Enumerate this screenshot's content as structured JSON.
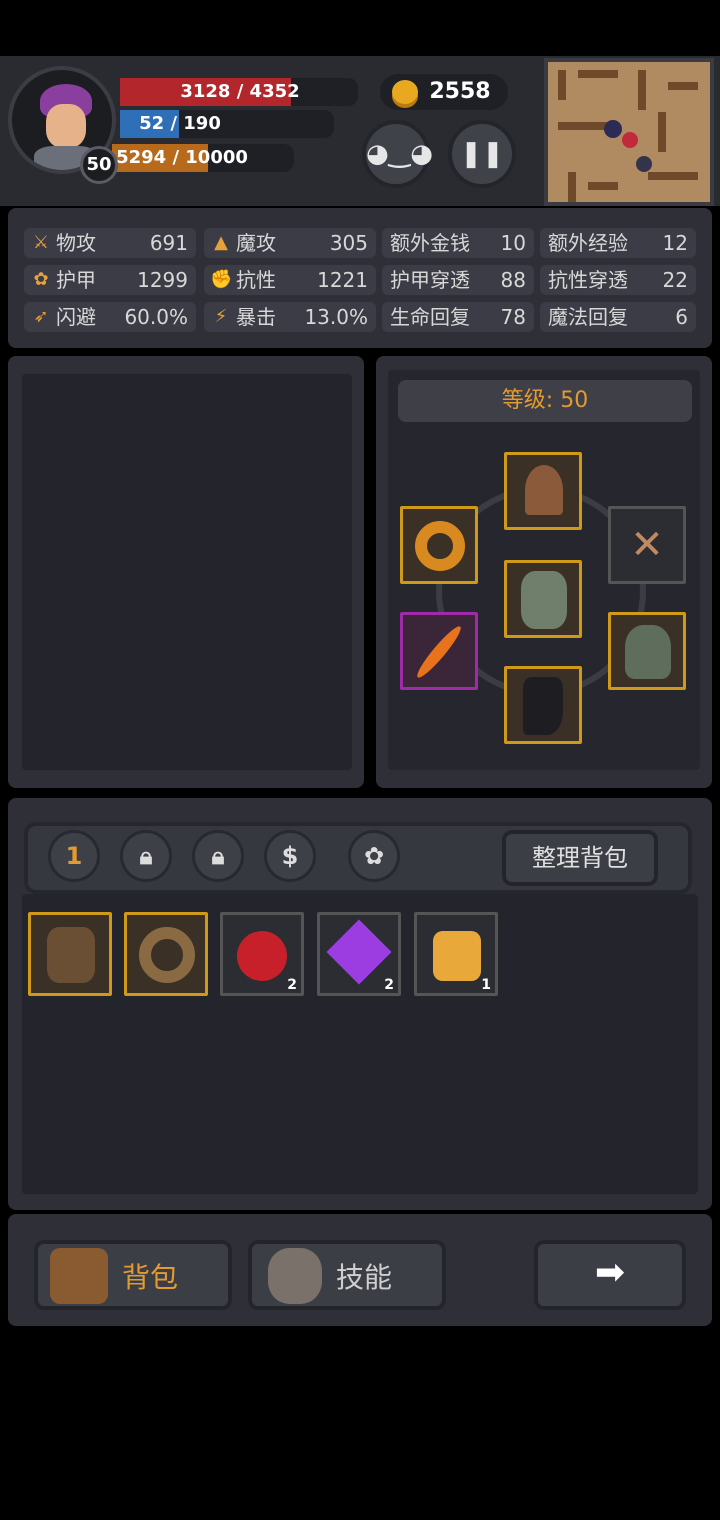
{
  "hud": {
    "level": "50",
    "hp_text": "3128 / 4352",
    "mp_text": "52 / 190",
    "xp_text": "5294 / 10000",
    "hp_fraction": 0.719,
    "mp_fraction": 0.274,
    "xp_fraction": 0.529,
    "gold": "2558",
    "colors": {
      "hp": "#b3262b",
      "mp": "#2f6fb7",
      "xp": "#b86a1c",
      "gold": "#e8a820"
    }
  },
  "stats": [
    {
      "name": "物攻",
      "value": "691",
      "icon": "sword-icon"
    },
    {
      "name": "魔攻",
      "value": "305",
      "icon": "wizard-hat-icon"
    },
    {
      "name": "额外金钱",
      "value": "10"
    },
    {
      "name": "额外经验",
      "value": "12"
    },
    {
      "name": "护甲",
      "value": "1299",
      "icon": "paw-icon"
    },
    {
      "name": "抗性",
      "value": "1221",
      "icon": "muscle-icon"
    },
    {
      "name": "护甲穿透",
      "value": "88"
    },
    {
      "name": "抗性穿透",
      "value": "22"
    },
    {
      "name": "闪避",
      "value": "60.0%",
      "icon": "running-icon"
    },
    {
      "name": "暴击",
      "value": "13.0%",
      "icon": "lightning-icon"
    },
    {
      "name": "生命回复",
      "value": "78"
    },
    {
      "name": "魔法回复",
      "value": "6"
    }
  ],
  "equipment": {
    "level_label": "等级: 50",
    "slots": [
      "helmet-icon",
      "ring-icon",
      "chain-lock-icon",
      "chest-armor-icon",
      "dagger-icon",
      "gauntlet-icon",
      "boots-icon"
    ]
  },
  "bag": {
    "tabs": [
      "1",
      "lock-icon",
      "lock-icon",
      "$",
      "paw-icon"
    ],
    "sort_label": "整理背包",
    "items": [
      {
        "icon": "leather-armor-icon",
        "count": ""
      },
      {
        "icon": "wooden-ring-icon",
        "count": ""
      },
      {
        "icon": "red-potion-icon",
        "count": "2"
      },
      {
        "icon": "purple-gem-icon",
        "count": "2"
      },
      {
        "icon": "scroll-icon",
        "count": "1"
      }
    ]
  },
  "bottom_nav": {
    "bag_label": "背包",
    "skill_label": "技能",
    "next_icon": "arrow-right-icon"
  }
}
